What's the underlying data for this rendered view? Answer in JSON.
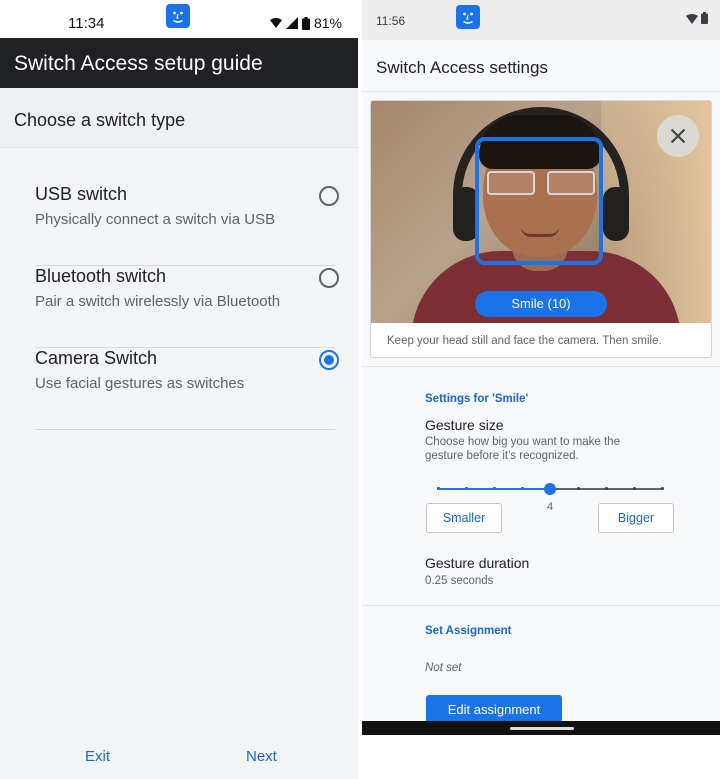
{
  "left": {
    "status": {
      "time": "11:34",
      "battery": "81%"
    },
    "appbar": {
      "title": "Switch Access setup guide"
    },
    "subheader": {
      "title": "Choose a switch type"
    },
    "options": [
      {
        "title": "USB switch",
        "description": "Physically connect a switch via USB",
        "selected": false
      },
      {
        "title": "Bluetooth switch",
        "description": "Pair a switch wirelessly via Bluetooth",
        "selected": false
      },
      {
        "title": "Camera Switch",
        "description": "Use facial gestures as switches",
        "selected": true
      }
    ],
    "buttons": {
      "exit": "Exit",
      "next": "Next"
    }
  },
  "right": {
    "status": {
      "time": "11:56"
    },
    "appbar": {
      "title": "Switch Access settings"
    },
    "camera": {
      "chip": "Smile (10)",
      "instruction": "Keep your head still and face the camera. Then smile."
    },
    "settings": {
      "section": "Settings for 'Smile'",
      "gesture_size": {
        "title": "Gesture size",
        "description": "Choose how big you want to make the gesture before it's recognized.",
        "value": "4",
        "level": 4,
        "steps": 9,
        "smaller": "Smaller",
        "bigger": "Bigger"
      },
      "gesture_duration": {
        "title": "Gesture duration",
        "value": "0.25 seconds"
      }
    },
    "assignment": {
      "section": "Set Assignment",
      "status": "Not set",
      "button": "Edit assignment"
    }
  },
  "colors": {
    "accent": "#1a73e8",
    "appbar_dark": "#202124"
  },
  "icons": [
    "switch-access-face-icon",
    "close-icon",
    "radio-button",
    "wifi-icon",
    "battery-icon"
  ]
}
